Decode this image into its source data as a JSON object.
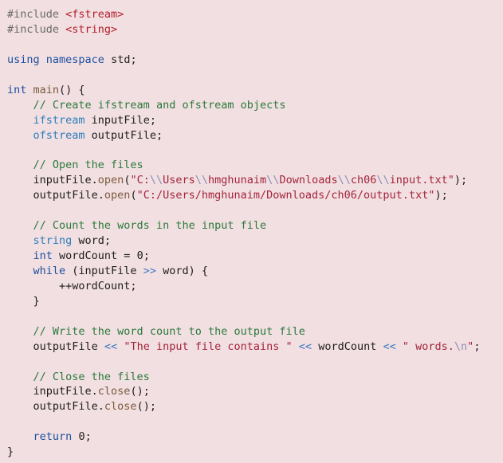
{
  "editor": {
    "colors": {
      "background": "#f2dfe1",
      "default": "#1d1d1d",
      "preprocessor": "#6a6a6a",
      "include_path": "#b3202d",
      "keyword": "#1c4fa0",
      "type": "#2a7dbb",
      "function": "#7a5a3c",
      "comment": "#2a7a3c",
      "string": "#a3243b",
      "escape": "#8a8fb8",
      "operator": "#3b78c3",
      "number": "#1d1d1d"
    },
    "lines": [
      [
        {
          "t": "#include ",
          "c": "preprocessor"
        },
        {
          "t": "<fstream>",
          "c": "include_path"
        }
      ],
      [
        {
          "t": "#include ",
          "c": "preprocessor"
        },
        {
          "t": "<string>",
          "c": "include_path"
        }
      ],
      [],
      [
        {
          "t": "using",
          "c": "keyword"
        },
        {
          "t": " ",
          "c": "default"
        },
        {
          "t": "namespace",
          "c": "keyword"
        },
        {
          "t": " std;",
          "c": "default"
        }
      ],
      [],
      [
        {
          "t": "int",
          "c": "keyword"
        },
        {
          "t": " ",
          "c": "default"
        },
        {
          "t": "main",
          "c": "function"
        },
        {
          "t": "() {",
          "c": "default"
        }
      ],
      [
        {
          "t": "    ",
          "c": "default"
        },
        {
          "t": "// Create ifstream and ofstream objects",
          "c": "comment"
        }
      ],
      [
        {
          "t": "    ",
          "c": "default"
        },
        {
          "t": "ifstream",
          "c": "type"
        },
        {
          "t": " inputFile;",
          "c": "default"
        }
      ],
      [
        {
          "t": "    ",
          "c": "default"
        },
        {
          "t": "ofstream",
          "c": "type"
        },
        {
          "t": " outputFile;",
          "c": "default"
        }
      ],
      [],
      [
        {
          "t": "    ",
          "c": "default"
        },
        {
          "t": "// Open the files",
          "c": "comment"
        }
      ],
      [
        {
          "t": "    inputFile.",
          "c": "default"
        },
        {
          "t": "open",
          "c": "function"
        },
        {
          "t": "(",
          "c": "default"
        },
        {
          "t": "\"C:",
          "c": "string"
        },
        {
          "t": "\\\\",
          "c": "escape"
        },
        {
          "t": "Users",
          "c": "string"
        },
        {
          "t": "\\\\",
          "c": "escape"
        },
        {
          "t": "hmghunaim",
          "c": "string"
        },
        {
          "t": "\\\\",
          "c": "escape"
        },
        {
          "t": "Downloads",
          "c": "string"
        },
        {
          "t": "\\\\",
          "c": "escape"
        },
        {
          "t": "ch06",
          "c": "string"
        },
        {
          "t": "\\\\",
          "c": "escape"
        },
        {
          "t": "input.txt\"",
          "c": "string"
        },
        {
          "t": ");",
          "c": "default"
        }
      ],
      [
        {
          "t": "    outputFile.",
          "c": "default"
        },
        {
          "t": "open",
          "c": "function"
        },
        {
          "t": "(",
          "c": "default"
        },
        {
          "t": "\"C:/Users/hmghunaim/Downloads/ch06/output.txt\"",
          "c": "string"
        },
        {
          "t": ");",
          "c": "default"
        }
      ],
      [],
      [
        {
          "t": "    ",
          "c": "default"
        },
        {
          "t": "// Count the words in the input file",
          "c": "comment"
        }
      ],
      [
        {
          "t": "    ",
          "c": "default"
        },
        {
          "t": "string",
          "c": "type"
        },
        {
          "t": " word;",
          "c": "default"
        }
      ],
      [
        {
          "t": "    ",
          "c": "default"
        },
        {
          "t": "int",
          "c": "keyword"
        },
        {
          "t": " wordCount = ",
          "c": "default"
        },
        {
          "t": "0",
          "c": "number"
        },
        {
          "t": ";",
          "c": "default"
        }
      ],
      [
        {
          "t": "    ",
          "c": "default"
        },
        {
          "t": "while",
          "c": "keyword"
        },
        {
          "t": " (inputFile ",
          "c": "default"
        },
        {
          "t": ">>",
          "c": "operator"
        },
        {
          "t": " word) {",
          "c": "default"
        }
      ],
      [
        {
          "t": "        ++wordCount;",
          "c": "default"
        }
      ],
      [
        {
          "t": "    }",
          "c": "default"
        }
      ],
      [],
      [
        {
          "t": "    ",
          "c": "default"
        },
        {
          "t": "// Write the word count to the output file",
          "c": "comment"
        }
      ],
      [
        {
          "t": "    outputFile ",
          "c": "default"
        },
        {
          "t": "<<",
          "c": "operator"
        },
        {
          "t": " ",
          "c": "default"
        },
        {
          "t": "\"The input file contains \"",
          "c": "string"
        },
        {
          "t": " ",
          "c": "default"
        },
        {
          "t": "<<",
          "c": "operator"
        },
        {
          "t": " wordCount ",
          "c": "default"
        },
        {
          "t": "<<",
          "c": "operator"
        },
        {
          "t": " ",
          "c": "default"
        },
        {
          "t": "\" words.",
          "c": "string"
        },
        {
          "t": "\\n",
          "c": "escape"
        },
        {
          "t": "\"",
          "c": "string"
        },
        {
          "t": ";",
          "c": "default"
        }
      ],
      [],
      [
        {
          "t": "    ",
          "c": "default"
        },
        {
          "t": "// Close the files",
          "c": "comment"
        }
      ],
      [
        {
          "t": "    inputFile.",
          "c": "default"
        },
        {
          "t": "close",
          "c": "function"
        },
        {
          "t": "();",
          "c": "default"
        }
      ],
      [
        {
          "t": "    outputFile.",
          "c": "default"
        },
        {
          "t": "close",
          "c": "function"
        },
        {
          "t": "();",
          "c": "default"
        }
      ],
      [],
      [
        {
          "t": "    ",
          "c": "default"
        },
        {
          "t": "return",
          "c": "keyword"
        },
        {
          "t": " ",
          "c": "default"
        },
        {
          "t": "0",
          "c": "number"
        },
        {
          "t": ";",
          "c": "default"
        }
      ],
      [
        {
          "t": "}",
          "c": "default"
        }
      ]
    ]
  }
}
